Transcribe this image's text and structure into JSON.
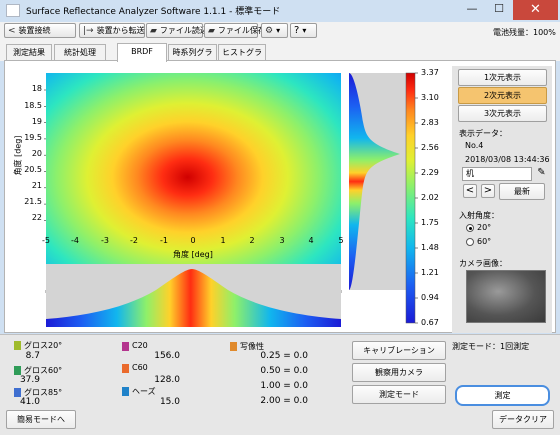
{
  "window": {
    "title": "Surface Reflectance Analyzer Software 1.1.1 - 標準モード",
    "minimize": "—",
    "maximize": "☐",
    "close": "✕"
  },
  "toolbar": {
    "connect": "装置接続",
    "transfer": "装置から転送",
    "file_read": "ファイル読込",
    "file_save": "ファイル保存",
    "settings_arrow": "▾",
    "help": "?",
    "help_arrow": "▾",
    "battery": "電池残量：100%"
  },
  "tabs": [
    "測定結果",
    "統計処理",
    "BRDF",
    "時系列グラフ",
    "ヒストグラム"
  ],
  "active_tab": "BRDF",
  "heatmap": {
    "y_axis_title": "角度 [deg]",
    "x_axis_title": "角度 [deg]",
    "y_ticks": [
      "18",
      "18.5",
      "19",
      "19.5",
      "20",
      "20.5",
      "21",
      "21.5",
      "22"
    ],
    "x_ticks": [
      "-5",
      "-4",
      "-3",
      "-2",
      "-1",
      "0",
      "1",
      "2",
      "3",
      "4",
      "5"
    ]
  },
  "chart_data": {
    "type": "heatmap",
    "x_range": [
      -5,
      5
    ],
    "y_range": [
      17.7,
      22.4
    ],
    "peak": {
      "x": -0.2,
      "y": 20.0,
      "value": 3.37
    },
    "value_range": [
      0.67,
      3.37
    ],
    "colorbar_ticks": [
      "3.37",
      "3.10",
      "2.83",
      "2.56",
      "2.29",
      "2.02",
      "1.75",
      "1.48",
      "1.21",
      "0.94",
      "0.67"
    ],
    "colorscale": [
      "#1b1bd6",
      "#1c5ef2",
      "#11b6ee",
      "#2de6c0",
      "#8ef06a",
      "#dff033",
      "#ffd12a",
      "#ff8820",
      "#ff2d12",
      "#d00000"
    ]
  },
  "view_buttons": {
    "one_d": "1次元表示",
    "two_d": "2次元表示",
    "three_d": "3次元表示",
    "active": "2次元表示"
  },
  "display_data": {
    "label": "表示データ：",
    "no": "No.4",
    "datetime": "2018/03/08 13:44:36",
    "name": "机",
    "prev": "<",
    "next": ">",
    "latest": "最新"
  },
  "incident_angle": {
    "label": "入射角度：",
    "options": [
      "20°",
      "60°"
    ],
    "selected": "20°"
  },
  "camera": {
    "label": "カメラ画像："
  },
  "measurements": {
    "gloss20": {
      "label": "グロス20°",
      "value": "8.7",
      "color": "#9fbb2c"
    },
    "gloss60": {
      "label": "グロス60°",
      "value": "37.9",
      "color": "#2f9c58"
    },
    "gloss85": {
      "label": "グロス85°",
      "value": "41.0",
      "color": "#3f6fd0"
    },
    "c20": {
      "label": "C20",
      "value": "156.0",
      "color": "#b4358e"
    },
    "c60": {
      "label": "C60",
      "value": "128.0",
      "color": "#ea6a2c"
    },
    "haze": {
      "label": "ヘーズ",
      "value": "15.0",
      "color": "#1f82c9"
    },
    "doi": {
      "label": "写像性",
      "color": "#e08a2c",
      "rows": [
        "0.25 = 0.0",
        "0.50 = 0.0",
        "1.00 = 0.0",
        "2.00 = 0.0"
      ]
    }
  },
  "actions": {
    "calibration": "キャリブレーション",
    "observation_camera": "観察用カメラ",
    "measurement_mode": "測定モード",
    "mode_status": "測定モード：1回測定",
    "measure": "測定",
    "simple_mode": "簡易モードへ",
    "data_clear": "データクリア"
  }
}
